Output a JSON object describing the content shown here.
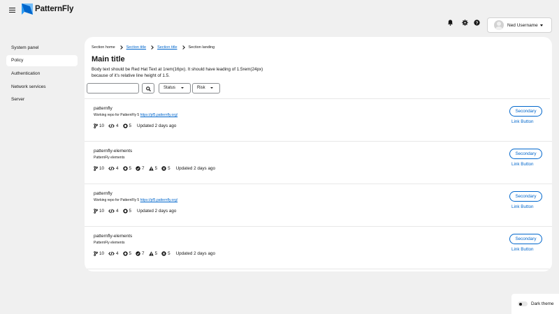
{
  "header": {
    "logo_text": "PatternFly",
    "user_name": "Ned Username",
    "icons": [
      "bell-icon",
      "gear-icon",
      "question-circle-icon"
    ]
  },
  "sidebar": {
    "items": [
      {
        "label": "System panel",
        "active": false
      },
      {
        "label": "Policy",
        "active": true
      },
      {
        "label": "Authentication",
        "active": false
      },
      {
        "label": "Network services",
        "active": false
      },
      {
        "label": "Server",
        "active": false
      }
    ]
  },
  "breadcrumb": [
    "Section home",
    "Section title",
    "Section title",
    "Section landing"
  ],
  "main": {
    "title": "Main title",
    "description": "Body text should be Red Hat Text at 1rem(16px). It should have leading of 1.5rem(24px) because of it’s relative line height of 1.5."
  },
  "toolbar": {
    "search_value": "",
    "status_label": "Status",
    "risk_label": "Risk"
  },
  "repos": [
    {
      "name": "patternfly",
      "desc_text": "Working repo for PatternFly 5 ",
      "desc_link": "https://pf5.patternfly.org/",
      "branches": "10",
      "prs": "4",
      "packages": "5",
      "checks": "",
      "warnings": "",
      "errors": "",
      "updated": "Updated 2 days ago",
      "secondary_label": "Secondary",
      "link_label": "Link Button"
    },
    {
      "name": "patternfly-elements",
      "desc_text": "PatternFly elements",
      "desc_link": "",
      "branches": "10",
      "prs": "4",
      "packages": "5",
      "checks": "7",
      "warnings": "5",
      "errors": "5",
      "updated": "Updated 2 days ago",
      "secondary_label": "Secondary",
      "link_label": "Link Button"
    },
    {
      "name": "patternfly",
      "desc_text": "Working repo for PatternFly 5 ",
      "desc_link": "https://pf5.patternfly.org/",
      "branches": "10",
      "prs": "4",
      "packages": "5",
      "checks": "",
      "warnings": "",
      "errors": "",
      "updated": "Updated 2 days ago",
      "secondary_label": "Secondary",
      "link_label": "Link Button"
    },
    {
      "name": "patternfly-elements",
      "desc_text": "PatternFly elements",
      "desc_link": "",
      "branches": "10",
      "prs": "4",
      "packages": "5",
      "checks": "7",
      "warnings": "5",
      "errors": "5",
      "updated": "Updated 2 days ago",
      "secondary_label": "Secondary",
      "link_label": "Link Button"
    }
  ],
  "theme_toggle": {
    "label": "Dark theme",
    "on": false
  },
  "colors": {
    "accent": "#0066cc",
    "background": "#f0f0f0",
    "surface": "#ffffff",
    "text": "#151515"
  }
}
